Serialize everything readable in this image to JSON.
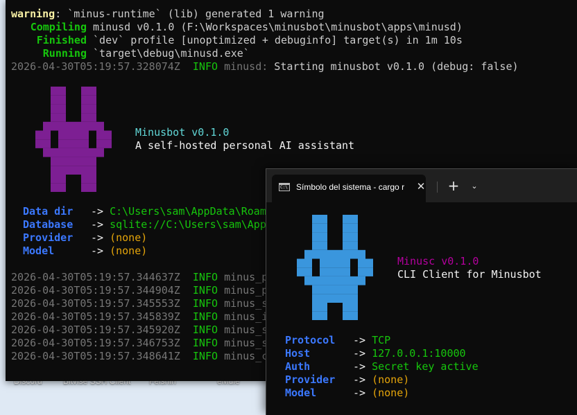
{
  "desktop": {
    "icons": [
      "Discord",
      "Bitvise SSH Client",
      "Feishin",
      "eMule"
    ]
  },
  "server_terminal": {
    "build_log": [
      {
        "status": "warning",
        "rest": ": `minus-runtime` (lib) generated 1 warning"
      },
      {
        "status": "Compiling",
        "rest": " minusd v0.1.0 (F:\\Workspaces\\minusbot\\minusbot\\apps\\minusd)"
      },
      {
        "status": "Finished",
        "rest": " `dev` profile [unoptimized + debuginfo] target(s) in 1m 10s"
      },
      {
        "status": "Running",
        "rest": " `target\\debug\\minusd.exe`"
      }
    ],
    "start_log": {
      "ts": "2026-04-30T05:19:57.328074Z",
      "level": "INFO",
      "module": "minusd:",
      "msg": " Starting minusbot v0.1.0 (debug: false)"
    },
    "banner": {
      "name": "Minusbot v0.1.0",
      "tagline": "A self-hosted personal AI assistant",
      "mascot_color": "#7d1f93"
    },
    "config": [
      {
        "key": "Data dir",
        "value": "C:\\Users\\sam\\AppData\\Roaming"
      },
      {
        "key": "Database",
        "value": "sqlite://C:\\Users\\sam\\AppData"
      },
      {
        "key": "Provider",
        "value": "(none)"
      },
      {
        "key": "Model",
        "value": "(none)"
      }
    ],
    "arrow": "->",
    "logs": [
      {
        "ts": "2026-04-30T05:19:57.344637Z",
        "level": "INFO",
        "module": "minus_p"
      },
      {
        "ts": "2026-04-30T05:19:57.344904Z",
        "level": "INFO",
        "module": "minus_p"
      },
      {
        "ts": "2026-04-30T05:19:57.345553Z",
        "level": "INFO",
        "module": "minus_s"
      },
      {
        "ts": "2026-04-30T05:19:57.345839Z",
        "level": "INFO",
        "module": "minus_i"
      },
      {
        "ts": "2026-04-30T05:19:57.345920Z",
        "level": "INFO",
        "module": "minus_s"
      },
      {
        "ts": "2026-04-30T05:19:57.346753Z",
        "level": "INFO",
        "module": "minus_s"
      },
      {
        "ts": "2026-04-30T05:19:57.348641Z",
        "level": "INFO",
        "module": "minus_c"
      }
    ]
  },
  "client_terminal": {
    "tab": {
      "title": "Símbolo del sistema - cargo  r",
      "icon": "cmd-icon",
      "close": "✕"
    },
    "new_tab": "+",
    "dropdown": "⌄",
    "banner": {
      "name": "Minusc v0.1.0",
      "tagline": "CLI Client for Minusbot",
      "mascot_color": "#3a96dd"
    },
    "config": [
      {
        "key": "Protocol",
        "value": "TCP"
      },
      {
        "key": "Host",
        "value": "127.0.0.1:10000"
      },
      {
        "key": "Auth",
        "value": "Secret key active"
      },
      {
        "key": "Provider",
        "value": "(none)"
      },
      {
        "key": "Model",
        "value": "(none)"
      }
    ],
    "arrow": "->"
  }
}
